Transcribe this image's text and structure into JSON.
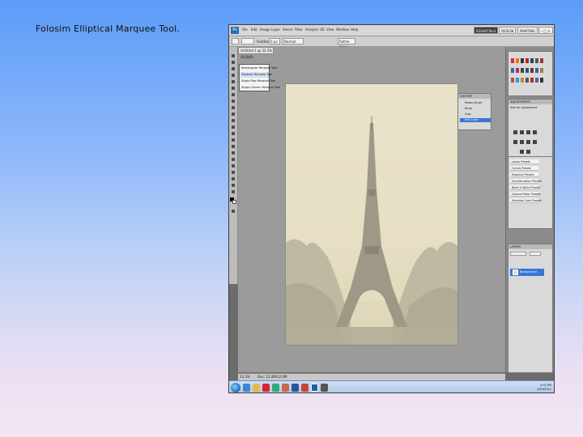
{
  "slide": {
    "title": "Folosim  Elliptical Marquee Tool."
  },
  "photoshop": {
    "menu": [
      "File",
      "Edit",
      "Image",
      "Layer",
      "Select",
      "Filter",
      "Analysis",
      "3D",
      "View",
      "Window",
      "Help"
    ],
    "workspace_buttons": [
      "ESSENTIALS",
      "DESIGN",
      "PAINTING"
    ],
    "options": {
      "feather_label": "Feather:",
      "feather_value": "0 px",
      "style_value": "Normal",
      "refine_label": "Refine Edge..."
    },
    "document_tab": "Untitled-1 @ 33.3% (RGB/8)",
    "tool_flyout": [
      "Rectangular Marquee Tool",
      "Elliptical Marquee Tool",
      "Single Row Marquee Tool",
      "Single Column Marquee Tool"
    ],
    "status": {
      "zoom": "33.3%",
      "doc_size": "Doc: 12.0M/12.0M"
    },
    "panels": {
      "adjustments_title": "ADJUSTMENTS",
      "adjustments_subtitle": "Add an adjustment",
      "presets": [
        "Levels Presets",
        "Curves Presets",
        "Exposure Presets",
        "Hue/Saturation Presets",
        "Black & White Presets",
        "Channel Mixer Presets",
        "Selective Color Presets"
      ],
      "history_items": [
        "History Brush",
        "Brush",
        "Crop",
        "New Layer"
      ],
      "layers_title": "LAYERS",
      "layer_name": "Background"
    },
    "taskbar": {
      "time": "4:35 PM",
      "date": "10/4/2011"
    }
  }
}
